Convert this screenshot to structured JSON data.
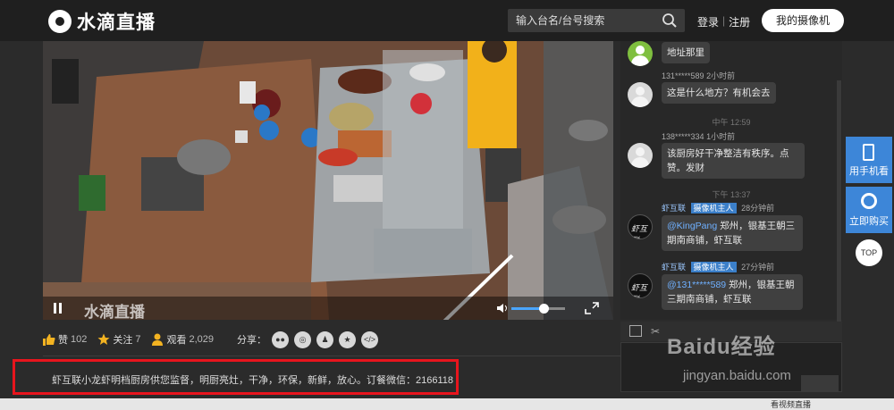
{
  "header": {
    "logo_text": "水滴直播",
    "search_placeholder": "输入台名/台号搜索",
    "login": "登录",
    "separator": "|",
    "register": "注册",
    "my_camera": "我的摄像机"
  },
  "video": {
    "watermark": "水滴直播",
    "volume_level": 0.6
  },
  "stats": {
    "like_label": "赞",
    "like_count": "102",
    "follow_label": "关注",
    "follow_count": "7",
    "view_label": "观看",
    "view_count": "2,029",
    "share_label": "分享："
  },
  "share_icons": [
    "wechat-icon",
    "weibo-icon",
    "qq-icon",
    "qzone-icon",
    "embed-code-icon"
  ],
  "description": "虾互联小龙虾明档厨房供您监督，明厨亮灶，干净，环保，新鲜，放心。订餐微信：2166118",
  "chat": {
    "messages": [
      {
        "text": "地址那里"
      },
      {
        "user": "131*****589",
        "time": "2小时前",
        "text": "这是什么地方？有机会去"
      },
      {
        "divider": "中午 12:59"
      },
      {
        "user": "138*****334",
        "time": "1小时前",
        "text": "该厨房好干净整洁有秩序。点赞。发财"
      },
      {
        "divider": "下午 13:37"
      },
      {
        "user": "虾互联",
        "badge": "摄像机主人",
        "time": "28分钟前",
        "mention": "@KingPang",
        "text": " 郑州，银基王朝三期南商铺，虾互联"
      },
      {
        "user": "虾互联",
        "badge": "摄像机主人",
        "time": "27分钟前",
        "mention": "@131*****589",
        "text": " 郑州，银基王朝三期南商铺，虾互联"
      }
    ]
  },
  "side": {
    "phone_watch": "用手机看",
    "buy_now": "立即购买",
    "top": "TOP"
  },
  "watermark": {
    "logo": "Baidu经验",
    "url": "jingyan.baidu.com"
  },
  "bottom": {
    "text": "看视频直播"
  }
}
